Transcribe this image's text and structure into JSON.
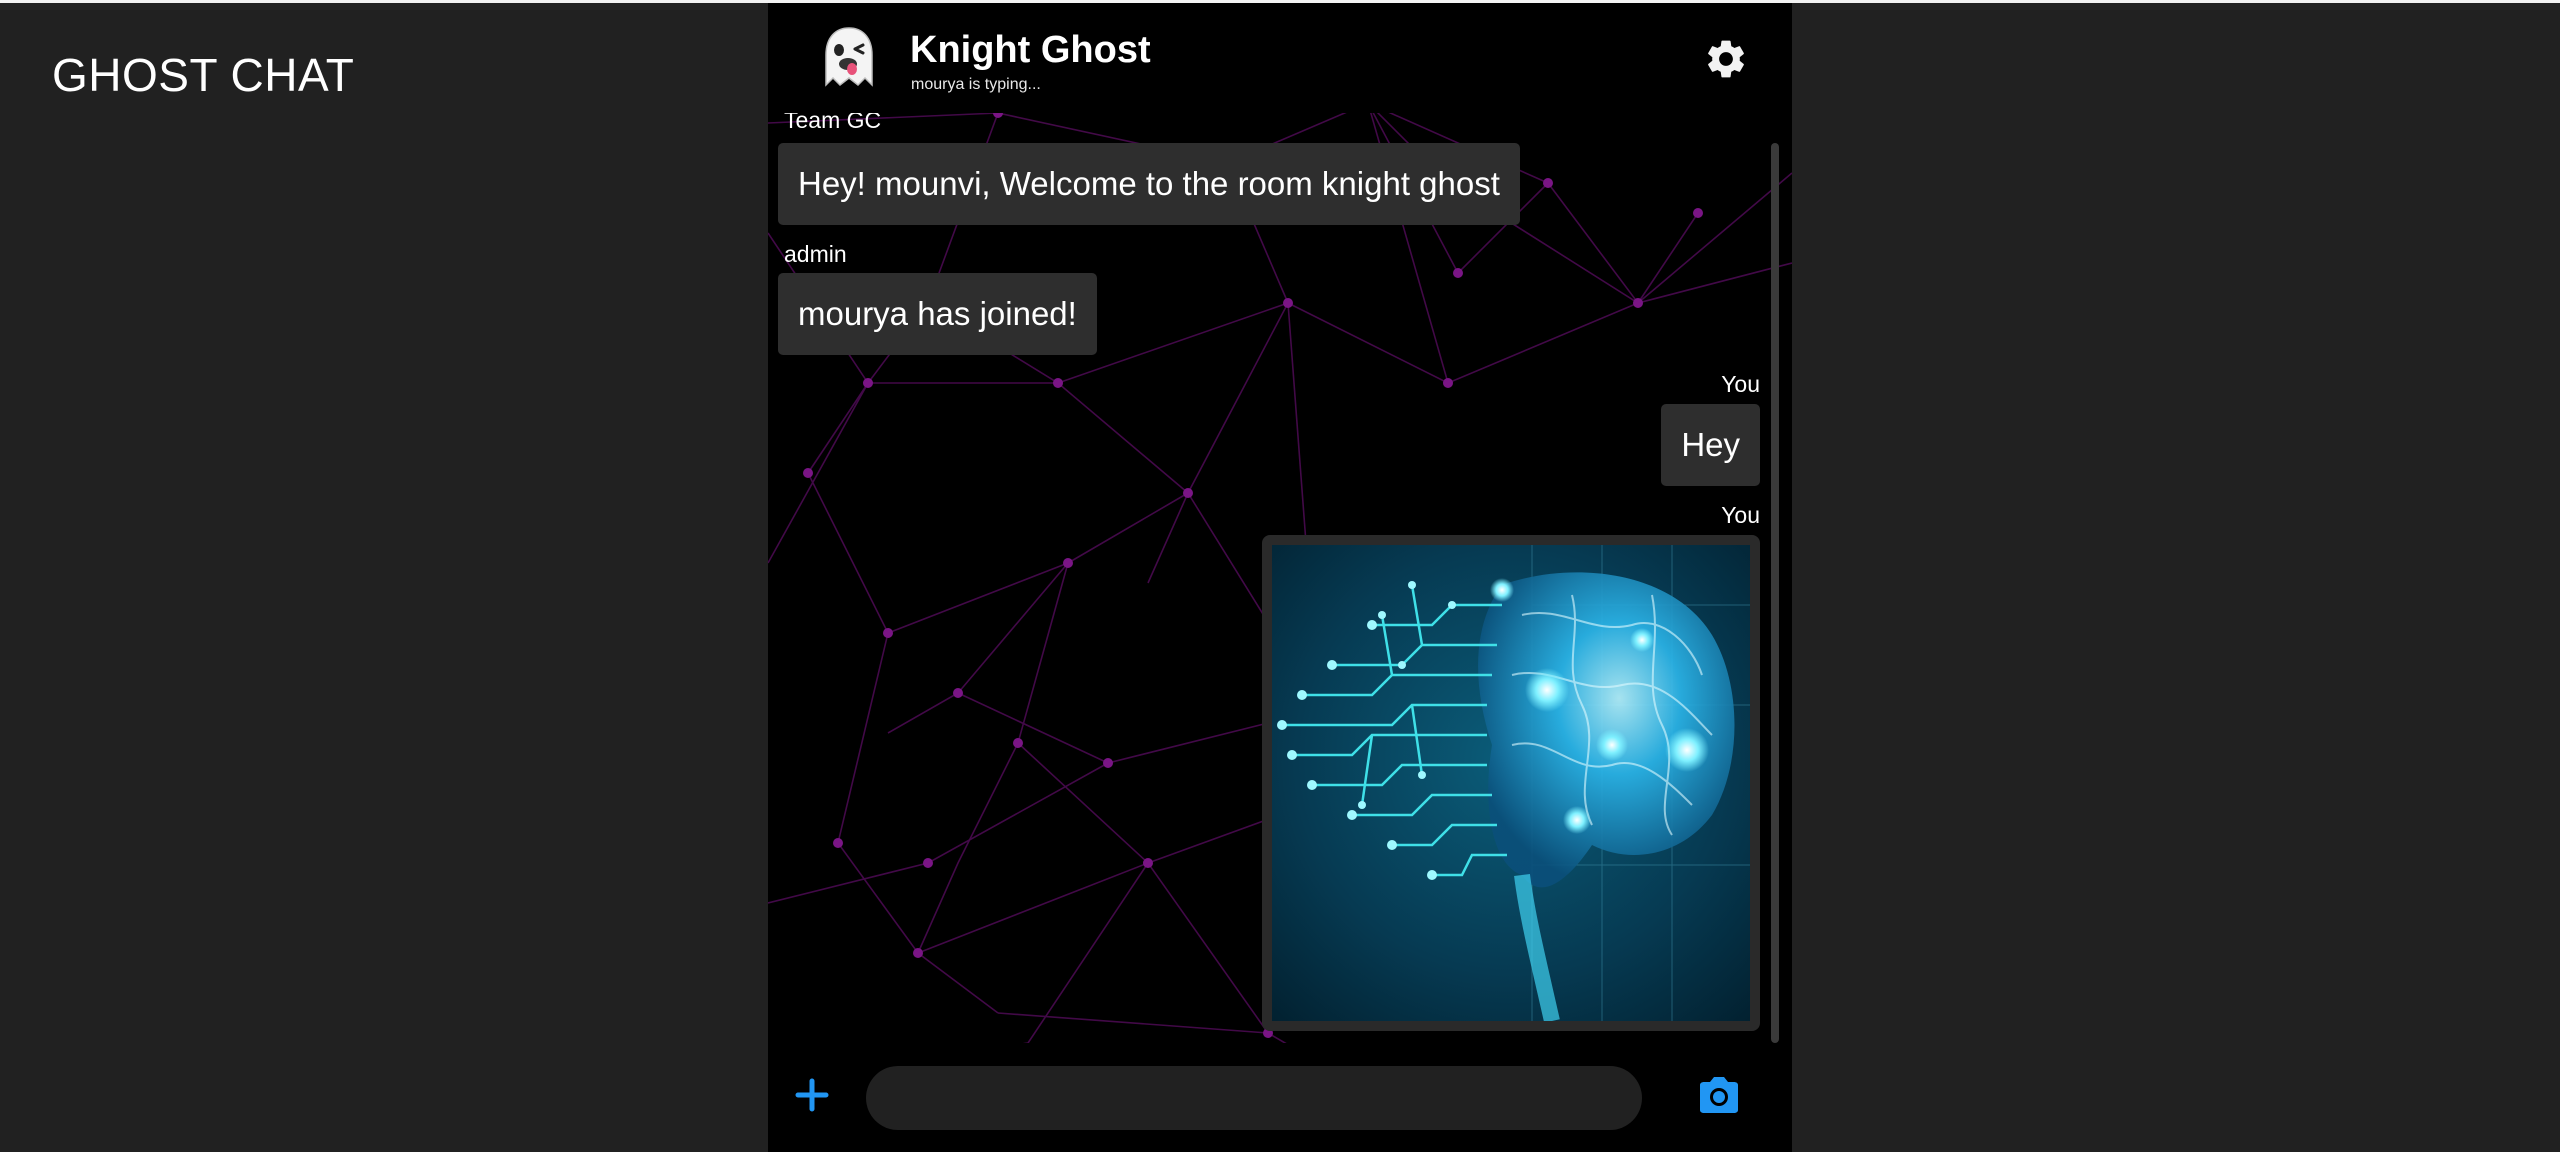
{
  "app": {
    "title": "GHOST CHAT"
  },
  "header": {
    "avatar_icon": "ghost-emoji-icon",
    "room_name": "Knight Ghost",
    "typing_status": "mourya is typing...",
    "settings_icon": "gear-icon"
  },
  "messages": [
    {
      "sender": "Team GC",
      "text": "Hey! mounvi, Welcome to the room knight ghost",
      "side": "left"
    },
    {
      "sender": "admin",
      "text": "mourya has joined!",
      "side": "left"
    },
    {
      "sender": "You",
      "text": "Hey",
      "side": "right"
    },
    {
      "sender": "You",
      "image": "glowing-brain-circuit-image",
      "side": "right"
    }
  ],
  "composer": {
    "attach_icon": "plus-icon",
    "input_value": "",
    "input_placeholder": "",
    "camera_icon": "camera-icon"
  },
  "colors": {
    "page_bg": "#212121",
    "chat_bg": "#000000",
    "bubble_bg": "#2e2e2e",
    "accent": "#2196f3",
    "network_lines": "#5a0a5e"
  }
}
